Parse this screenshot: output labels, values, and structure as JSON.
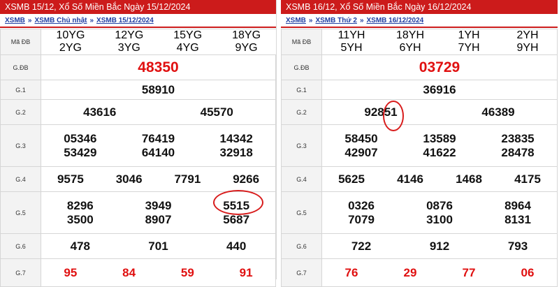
{
  "left": {
    "title": "XSMB 15/12, Xổ Số Miền Bắc Ngày 15/12/2024",
    "breadcrumb": [
      "XSMB",
      "XSMB Chủ nhật",
      "XSMB 15/12/2024"
    ],
    "madb_label": "Mã ĐB",
    "codes": [
      [
        "10YG",
        "2YG"
      ],
      [
        "12YG",
        "3YG"
      ],
      [
        "15YG",
        "4YG"
      ],
      [
        "18YG",
        "9YG"
      ]
    ],
    "labels": {
      "gdb": "G.ĐB",
      "g1": "G.1",
      "g2": "G.2",
      "g3": "G.3",
      "g4": "G.4",
      "g5": "G.5",
      "g6": "G.6",
      "g7": "G.7"
    },
    "gdb": "48350",
    "g1": "58910",
    "g2": [
      "43616",
      "45570"
    ],
    "g3": [
      "05346",
      "76419",
      "14342",
      "53429",
      "64140",
      "32918"
    ],
    "g4": [
      "9575",
      "3046",
      "7791",
      "9266"
    ],
    "g5": [
      "8296",
      "3949",
      "5515",
      "3500",
      "8907",
      "5687"
    ],
    "g6": [
      "478",
      "701",
      "440"
    ],
    "g7": [
      "95",
      "84",
      "59",
      "91"
    ]
  },
  "right": {
    "title": "XSMB 16/12, Xổ Số Miền Bắc Ngày 16/12/2024",
    "breadcrumb": [
      "XSMB",
      "XSMB Thứ 2",
      "XSMB 16/12/2024"
    ],
    "madb_label": "Mã ĐB",
    "codes": [
      [
        "11YH",
        "5YH"
      ],
      [
        "18YH",
        "6YH"
      ],
      [
        "1YH",
        "7YH"
      ],
      [
        "2YH",
        "9YH"
      ]
    ],
    "labels": {
      "gdb": "G.ĐB",
      "g1": "G.1",
      "g2": "G.2",
      "g3": "G.3",
      "g4": "G.4",
      "g5": "G.5",
      "g6": "G.6",
      "g7": "G.7"
    },
    "gdb": "03729",
    "g1": "36916",
    "g2": [
      "92851",
      "46389"
    ],
    "g3": [
      "58450",
      "13589",
      "23835",
      "42907",
      "41622",
      "28478"
    ],
    "g4": [
      "5625",
      "4146",
      "1468",
      "4175"
    ],
    "g5": [
      "0326",
      "0876",
      "8964",
      "7079",
      "3100",
      "8131"
    ],
    "g6": [
      "722",
      "912",
      "793"
    ],
    "g7": [
      "76",
      "29",
      "77",
      "06"
    ]
  },
  "colors": {
    "header_red": "#cc1b1b",
    "code_blue": "#2345b6",
    "prize_red": "#e01010",
    "circle_red": "#d81c1c"
  }
}
